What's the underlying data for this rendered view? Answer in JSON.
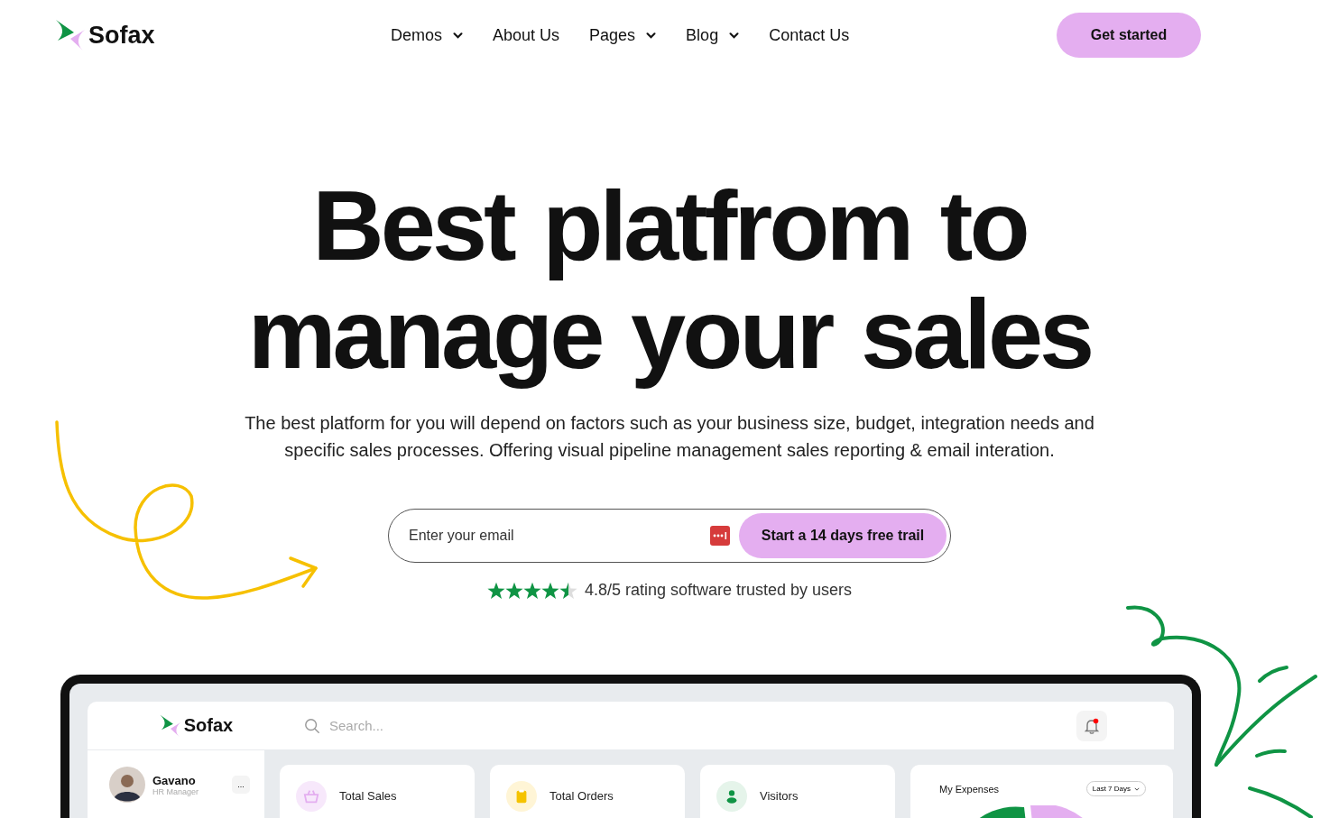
{
  "nav": {
    "brand": "Sofax",
    "links": [
      {
        "label": "Demos",
        "dropdown": true
      },
      {
        "label": "About Us",
        "dropdown": false
      },
      {
        "label": "Pages",
        "dropdown": true
      },
      {
        "label": "Blog",
        "dropdown": true
      },
      {
        "label": "Contact Us",
        "dropdown": false
      }
    ],
    "cta": "Get started"
  },
  "hero": {
    "title_lines": [
      "Best platfrom to",
      "manage your sales"
    ],
    "subtitle": "The best platform for you will depend on factors such as your business size, budget, integration needs and specific sales processes. Offering visual pipeline management sales reporting & email interation.",
    "email": {
      "placeholder": "Enter your email"
    },
    "submit": "Start a 14 days free trail",
    "rating": {
      "stars": 4.5,
      "text": "4.8/5 rating software trusted by users"
    }
  },
  "dashboard": {
    "brand": "Sofax",
    "search": {
      "placeholder": "Search..."
    },
    "notification": true,
    "user": {
      "name": "Gavano",
      "role": "HR Manager",
      "more": "..."
    },
    "cards": [
      {
        "kind": "sales",
        "label": "Total Sales"
      },
      {
        "kind": "orders",
        "label": "Total Orders"
      },
      {
        "kind": "visitors",
        "label": "Visitors"
      }
    ],
    "expenses": {
      "title": "My Expenses",
      "period": "Last 7 Days"
    }
  }
}
